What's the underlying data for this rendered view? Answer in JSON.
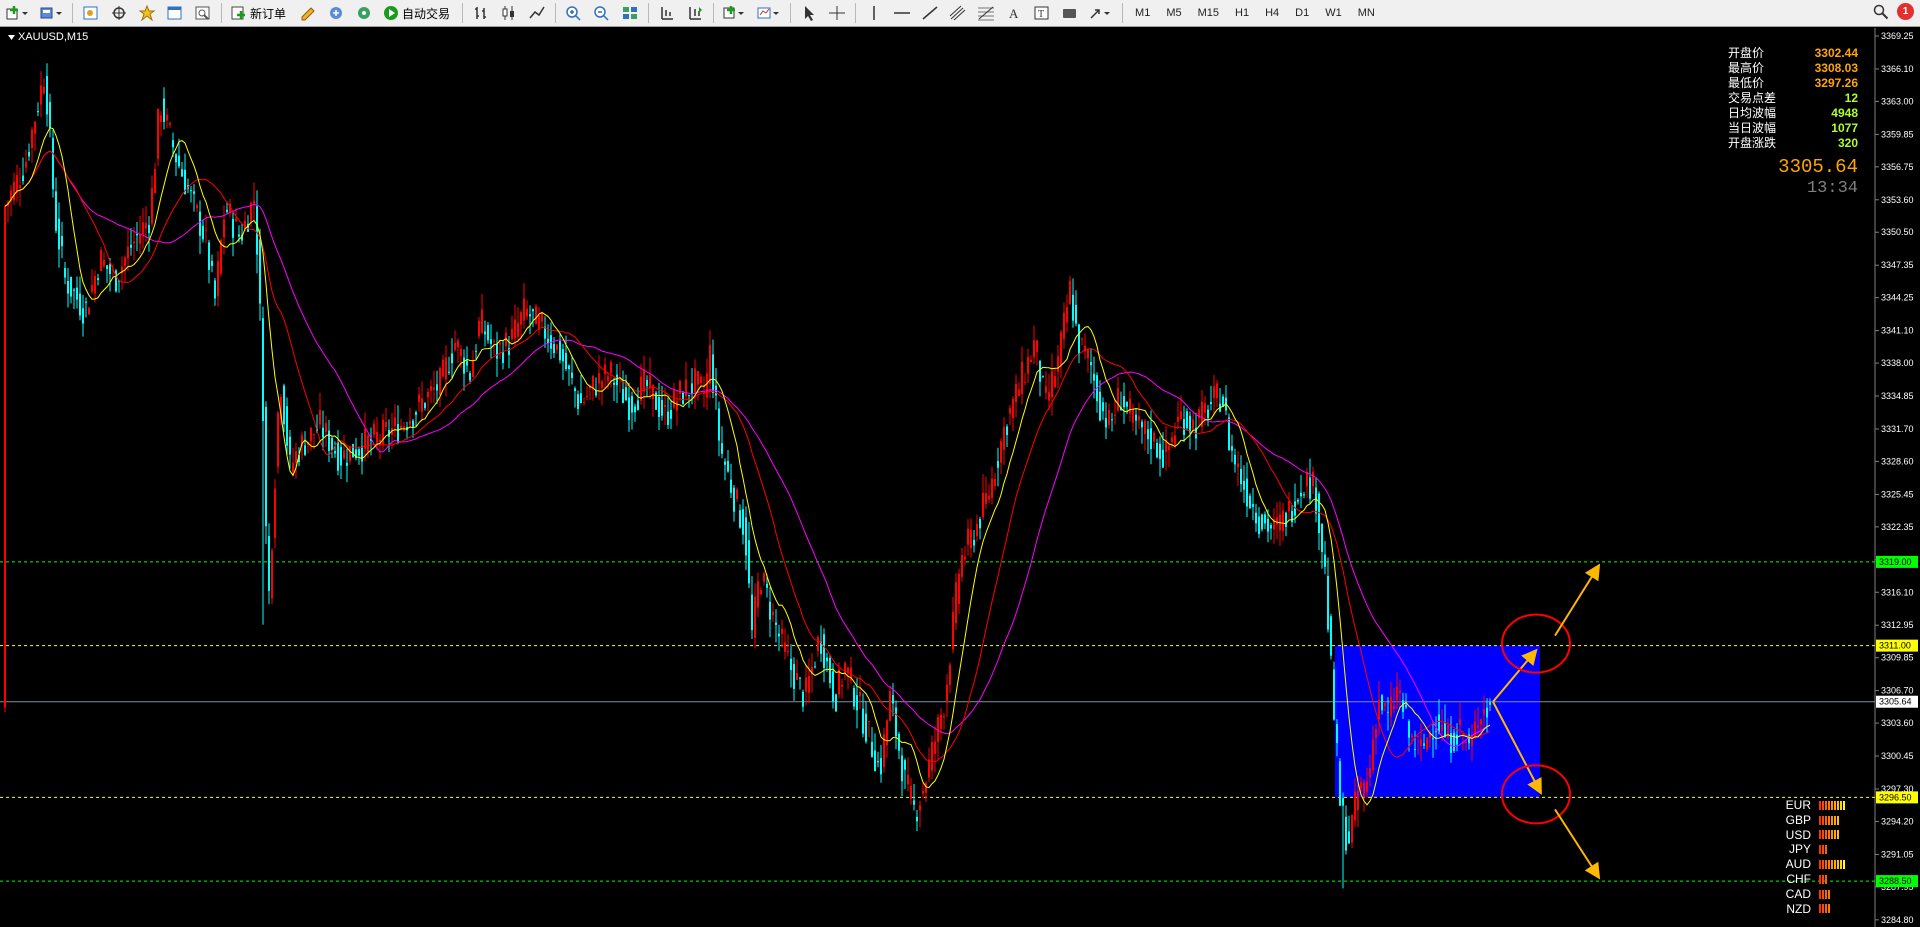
{
  "toolbar": {
    "new_order_label": "新订单",
    "auto_trade_label": "自动交易",
    "timeframes": [
      "M1",
      "M5",
      "M15",
      "H1",
      "H4",
      "D1",
      "W1",
      "MN"
    ],
    "notification_count": "1"
  },
  "chart": {
    "symbol_label": "XAUUSD,M15",
    "colors": {
      "background": "#000000",
      "bull": "#ff0000",
      "bear": "#00ffff",
      "ma_fast": "#ffff00",
      "ma_mid": "#ff0000",
      "ma_slow": "#ff00ff",
      "range_box": "#0000ff",
      "arrow": "#ffb800",
      "circle": "#ff0000",
      "level_green": "#00ff00",
      "level_yellow": "#ffff00",
      "current_line": "#8090a0"
    },
    "axis_ticks": [
      "3369.25",
      "3366.10",
      "3363.00",
      "3359.85",
      "3356.75",
      "3353.60",
      "3350.50",
      "3347.35",
      "3344.25",
      "3341.10",
      "3338.00",
      "3334.85",
      "3331.70",
      "3328.60",
      "3325.45",
      "3322.35",
      "3319.20",
      "3316.10",
      "3312.95",
      "3309.85",
      "3306.70",
      "3303.60",
      "3300.45",
      "3297.30",
      "3294.20",
      "3291.05",
      "3287.95",
      "3284.80"
    ],
    "levels": [
      {
        "price": "3319.00",
        "color": "#00ff00",
        "text_color": "#000000"
      },
      {
        "price": "3311.00",
        "color": "#ffff00",
        "text_color": "#000000"
      },
      {
        "price": "3296.50",
        "color": "#ffff00",
        "text_color": "#000000"
      },
      {
        "price": "3288.50",
        "color": "#00ff00",
        "text_color": "#000000"
      }
    ],
    "current_price_tag": "3305.64",
    "range_box": {
      "price_top": 3311.0,
      "price_bottom": 3296.5
    },
    "scenarios": [
      {
        "direction": "up",
        "break_level": 3311.0,
        "target": 3319.0
      },
      {
        "direction": "down",
        "break_level": 3296.5,
        "target": 3288.5
      }
    ]
  },
  "quote_panel": {
    "rows": [
      {
        "label": "开盘价",
        "value": "3302.44",
        "color": "#ffa500"
      },
      {
        "label": "最高价",
        "value": "3308.03",
        "color": "#ffa500"
      },
      {
        "label": "最低价",
        "value": "3297.26",
        "color": "#ffa500"
      },
      {
        "label": "交易点差",
        "value": "12",
        "color": "#adff2f"
      },
      {
        "label": "日均波幅",
        "value": "4948",
        "color": "#adff2f"
      },
      {
        "label": "当日波幅",
        "value": "1077",
        "color": "#adff2f"
      },
      {
        "label": "开盘涨跌",
        "value": "320",
        "color": "#adff2f"
      }
    ],
    "price": "3305.64",
    "time": "13:34"
  },
  "currency_strength": [
    {
      "code": "EUR",
      "level": 9
    },
    {
      "code": "GBP",
      "level": 7
    },
    {
      "code": "USD",
      "level": 7
    },
    {
      "code": "JPY",
      "level": 3
    },
    {
      "code": "AUD",
      "level": 9
    },
    {
      "code": "CHF",
      "level": 3
    },
    {
      "code": "CAD",
      "level": 4
    },
    {
      "code": "NZD",
      "level": 4
    }
  ]
}
